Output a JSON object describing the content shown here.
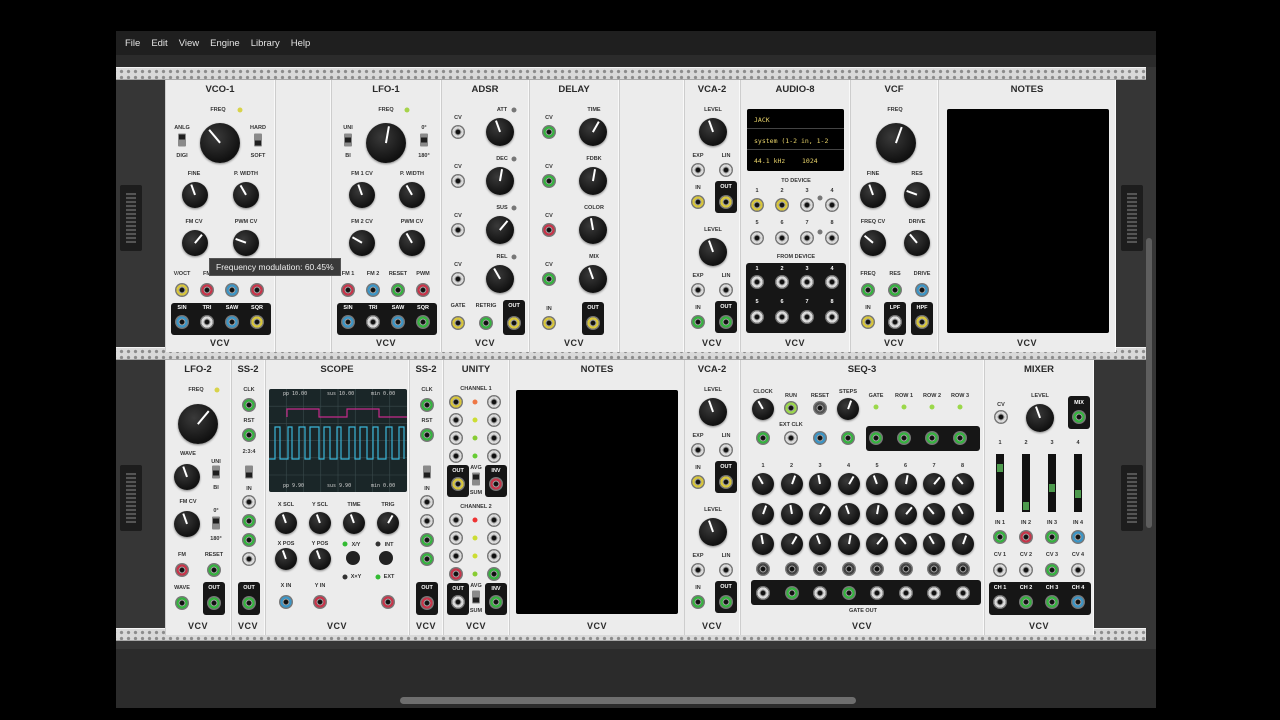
{
  "menu": [
    "File",
    "Edit",
    "View",
    "Engine",
    "Library",
    "Help"
  ],
  "tooltip": "Frequency modulation: 60.45%",
  "brand": "VCV",
  "colors": {
    "yellow": "#d8c63b",
    "green": "#35b33f",
    "blue": "#3b95c6",
    "red": "#c7354a",
    "white": "#dadada"
  },
  "row1": {
    "vco1": {
      "title": "VCO-1",
      "freq": "FREQ",
      "anlg": "ANLG",
      "digi": "DIGI",
      "hard": "HARD",
      "soft": "SOFT",
      "fine": "FINE",
      "pwidth": "P. WIDTH",
      "fmcv": "FM CV",
      "pwmcv": "PWM CV",
      "in": [
        "V/OCT",
        "FM",
        "SYNC",
        "PWM"
      ],
      "out": [
        "SIN",
        "TRI",
        "SAW",
        "SQR"
      ]
    },
    "lfo1": {
      "title": "LFO-1",
      "freq": "FREQ",
      "uni": "UNI",
      "bi": "BI",
      "deg0": "0°",
      "deg180": "180°",
      "fm1cv": "FM 1 CV",
      "pwidth": "P. WIDTH",
      "fm2cv": "FM 2 CV",
      "pwmcv": "PWM CV",
      "in": [
        "FM 1",
        "FM 2",
        "RESET",
        "PWM"
      ],
      "out": [
        "SIN",
        "TRI",
        "SAW",
        "SQR"
      ]
    },
    "adsr": {
      "title": "ADSR",
      "cv": "CV",
      "att": "ATT",
      "dec": "DEC",
      "sus": "SUS",
      "rel": "REL",
      "gate": "GATE",
      "retrig": "RETRIG",
      "out": "OUT"
    },
    "delay": {
      "title": "DELAY",
      "cv": "CV",
      "time": "TIME",
      "fdbk": "FDBK",
      "color": "COLOR",
      "mix": "MIX",
      "in": "IN",
      "out": "OUT"
    },
    "vca2": {
      "title": "VCA-2",
      "level": "LEVEL",
      "exp": "EXP",
      "lin": "LIN",
      "in": "IN",
      "out": "OUT"
    },
    "audio8": {
      "title": "AUDIO-8",
      "driver": "JACK",
      "device": "system (1-2 in, 1-2",
      "rate": "44.1 kHz",
      "block": "1024",
      "to_device": "TO DEVICE",
      "from_device": "FROM DEVICE",
      "nums": [
        "1",
        "2",
        "3",
        "4",
        "5",
        "6",
        "7",
        "8"
      ]
    },
    "vcf": {
      "title": "VCF",
      "freq": "FREQ",
      "fine": "FINE",
      "res": "RES",
      "freqcv": "FREQ CV",
      "drive": "DRIVE",
      "in_labels": [
        "FREQ",
        "RES",
        "DRIVE"
      ],
      "in": "IN",
      "lpf": "LPF",
      "hpf": "HPF"
    },
    "notes": {
      "title": "NOTES"
    }
  },
  "row2": {
    "lfo2": {
      "title": "LFO-2",
      "freq": "FREQ",
      "wave": "WAVE",
      "uni": "UNI",
      "bi": "BI",
      "fmcv": "FM CV",
      "deg0": "0°",
      "deg180": "180°",
      "fm": "FM",
      "reset": "RESET",
      "waveout": "WAVE",
      "out": "OUT"
    },
    "ss2a": {
      "title": "SS-2",
      "clk": "CLK",
      "rst": "RST",
      "mode": "2:3:4",
      "in": "IN",
      "out": "OUT"
    },
    "scope": {
      "title": "SCOPE",
      "top": [
        "pp 10.00",
        "sus 10.00",
        "min 0.00"
      ],
      "bot": [
        "pp 9.90",
        "sus 9.90",
        "min 0.00"
      ],
      "xscl": "X SCL",
      "yscl": "Y SCL",
      "time": "TIME",
      "trig": "TRIG",
      "xpos": "X POS",
      "ypos": "Y POS",
      "xy": "X/Y",
      "xxy": "X×Y",
      "int": "INT",
      "ext": "EXT",
      "xin": "X IN",
      "yin": "Y IN"
    },
    "ss2b": {
      "title": "SS-2",
      "clk": "CLK",
      "rst": "RST",
      "in": "IN",
      "out": "OUT"
    },
    "unity": {
      "title": "UNITY",
      "ch1": "CHANNEL 1",
      "ch2": "CHANNEL 2",
      "out": "OUT",
      "avg": "AVG",
      "sum": "SUM",
      "inv": "INV"
    },
    "notes": {
      "title": "NOTES"
    },
    "vca2": {
      "title": "VCA-2",
      "level": "LEVEL",
      "exp": "EXP",
      "lin": "LIN",
      "in": "IN",
      "out": "OUT"
    },
    "seq3": {
      "title": "SEQ-3",
      "clock": "CLOCK",
      "run": "RUN",
      "reset": "RESET",
      "steps": "STEPS",
      "extclk": "EXT CLK",
      "gate": "GATE",
      "row1": "ROW 1",
      "row2": "ROW 2",
      "row3": "ROW 3",
      "steps_n": [
        "1",
        "2",
        "3",
        "4",
        "5",
        "6",
        "7",
        "8"
      ],
      "gateout": "GATE OUT"
    },
    "mixer": {
      "title": "MIXER",
      "cv": "CV",
      "level": "LEVEL",
      "mix": "MIX",
      "ch": [
        "1",
        "2",
        "3",
        "4"
      ],
      "in": [
        "IN 1",
        "IN 2",
        "IN 3",
        "IN 4"
      ],
      "cv_l": [
        "CV 1",
        "CV 2",
        "CV 3",
        "CV 4"
      ],
      "out": [
        "CH 1",
        "CH 2",
        "CH 3",
        "CH 4"
      ]
    }
  }
}
